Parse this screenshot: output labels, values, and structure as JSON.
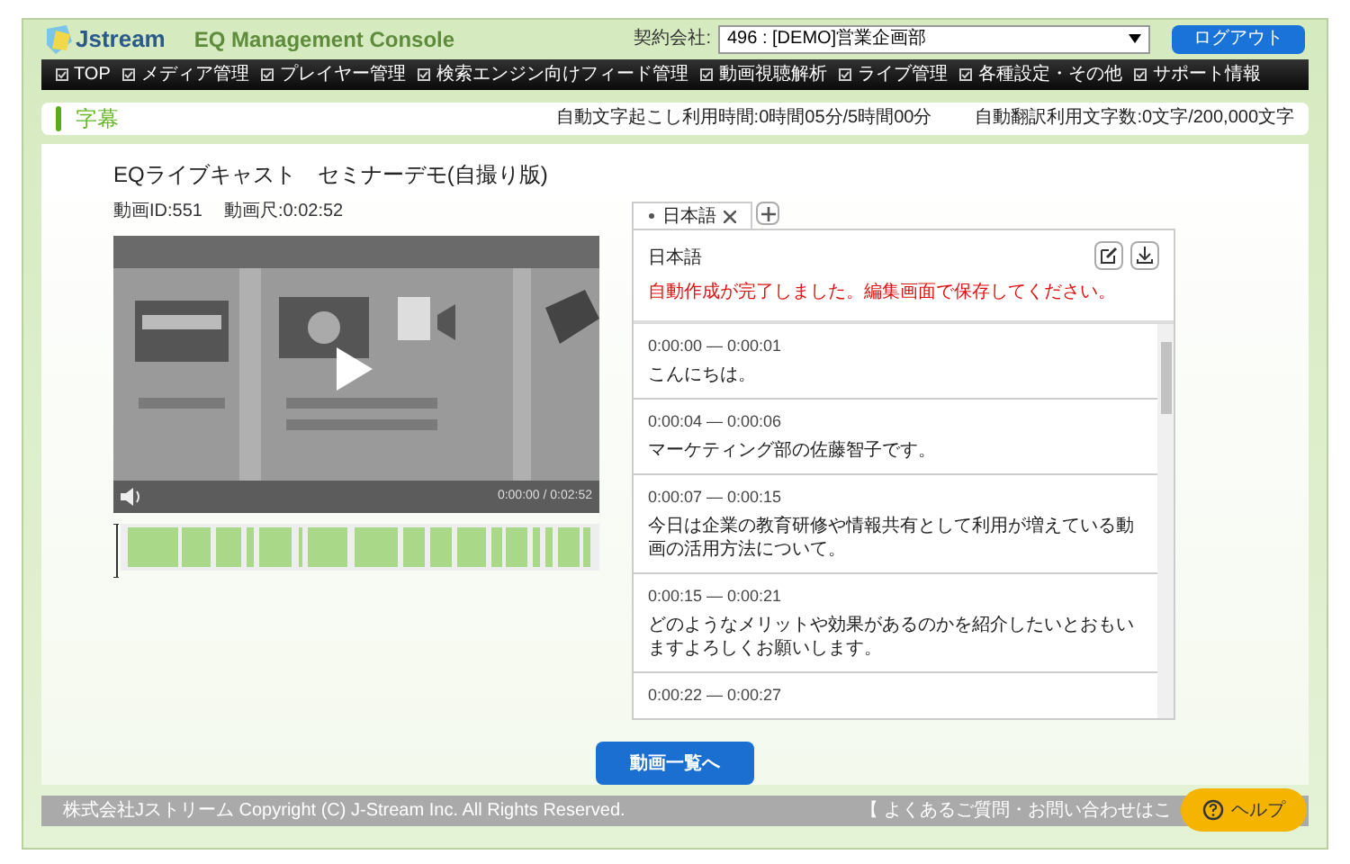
{
  "header": {
    "logo": "Jstream",
    "title": "EQ Management Console",
    "contract_label": "契約会社:",
    "contract_value": "496 : [DEMO]営業企画部",
    "logout": "ログアウト"
  },
  "nav": [
    "TOP",
    "メディア管理",
    "プレイヤー管理",
    "検索エンジン向けフィード管理",
    "動画視聴解析",
    "ライブ管理",
    "各種設定・その他",
    "サポート情報"
  ],
  "page_title": "字幕",
  "usage": [
    "自動文字起こし利用時間:0時間05分/5時間00分",
    "自動翻訳利用文字数:0文字/200,000文字"
  ],
  "video": {
    "title": "EQライブキャスト　セミナーデモ(自撮り版)",
    "id": "動画ID:551",
    "duration": "動画尺:0:02:52",
    "time": "0:00:00 / 0:02:52"
  },
  "tabs": [
    {
      "label": "日本語",
      "selected": true
    }
  ],
  "caption_panel": {
    "language": "日本語",
    "notice": "自動作成が完了しました。編集画面で保存してください。"
  },
  "captions": [
    {
      "time": "0:00:00 — 0:00:01",
      "text": "こんにちは。"
    },
    {
      "time": "0:00:04 — 0:00:06",
      "text": "マーケティング部の佐藤智子です。"
    },
    {
      "time": "0:00:07 — 0:00:15",
      "text": "今日は企業の教育研修や情報共有として利用が増えている動画の活用方法について。"
    },
    {
      "time": "0:00:15 — 0:00:21",
      "text": "どのようなメリットや効果があるのかを紹介したいとおもいますよろしくお願いします。"
    },
    {
      "time": "0:00:22 — 0:00:27"
    }
  ],
  "back_button": "動画一覧へ",
  "footer": {
    "copyright": "株式会社Jストリーム  Copyright (C) J-Stream Inc. All Rights Reserved.",
    "link": "【 よくあるご質問・お問い合わせはこ"
  },
  "help": "ヘルプ"
}
